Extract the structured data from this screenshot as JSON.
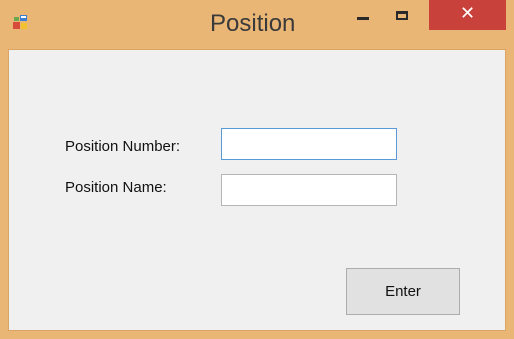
{
  "window": {
    "title": "Position",
    "app_icon": "form-icon",
    "controls": {
      "minimize_icon": "minimize-icon",
      "maximize_icon": "maximize-icon",
      "close_icon": "close-icon",
      "close_glyph": "✕"
    }
  },
  "form": {
    "position_number_label": "Position Number:",
    "position_number_value": "",
    "position_name_label": "Position Name:",
    "position_name_value": "",
    "enter_label": "Enter"
  },
  "colors": {
    "titlebar": "#eab676",
    "close_button": "#c8413b",
    "client_background": "#f0f0f0",
    "focused_border": "#5b9bd5"
  }
}
